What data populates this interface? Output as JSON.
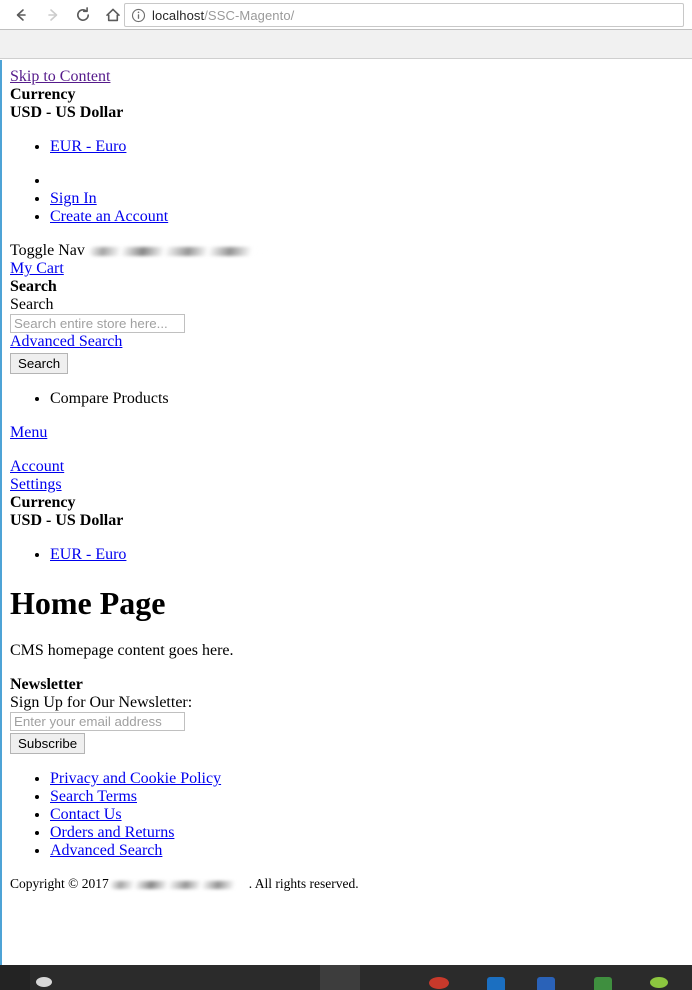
{
  "browser": {
    "back_label": "Back",
    "forward_label": "Forward",
    "reload_label": "Reload this page",
    "home_label": "Home",
    "site_info_label": "View site information",
    "url_host": "localhost",
    "url_path": "/SSC-Magento/"
  },
  "page": {
    "skip_to_content": "Skip to Content",
    "header": {
      "currency_label": "Currency",
      "currency_selected": "USD - US Dollar",
      "currency_options": [
        "EUR - Euro"
      ],
      "account_links": [
        "Sign In",
        "Create an Account"
      ],
      "toggle_nav": "Toggle Nav",
      "my_cart": "My Cart",
      "search_heading": "Search",
      "search_label": "Search",
      "search_placeholder": "Search entire store here...",
      "advanced_search": "Advanced Search",
      "search_button": "Search",
      "compare_products": "Compare Products",
      "menu": "Menu"
    },
    "sidebar": {
      "account": "Account",
      "settings": "Settings",
      "currency_label": "Currency",
      "currency_selected": "USD - US Dollar",
      "currency_options": [
        "EUR - Euro"
      ]
    },
    "main": {
      "title": "Home Page",
      "body": "CMS homepage content goes here."
    },
    "newsletter": {
      "heading": "Newsletter",
      "label": "Sign Up for Our Newsletter:",
      "placeholder": "Enter your email address",
      "subscribe_button": "Subscribe"
    },
    "footer": {
      "links": [
        "Privacy and Cookie Policy",
        "Search Terms",
        "Contact Us",
        "Orders and Returns",
        "Advanced Search"
      ],
      "copyright_prefix": "Copyright © 2017",
      "copyright_suffix": ". All rights reserved."
    }
  },
  "colors": {
    "link": "#0000ee",
    "link_visited": "#551a8b",
    "chrome_bookmark_bar": "#f1f1f1",
    "taskbar": "#2b2b2b",
    "viewport_edge": "#4da3d6"
  }
}
